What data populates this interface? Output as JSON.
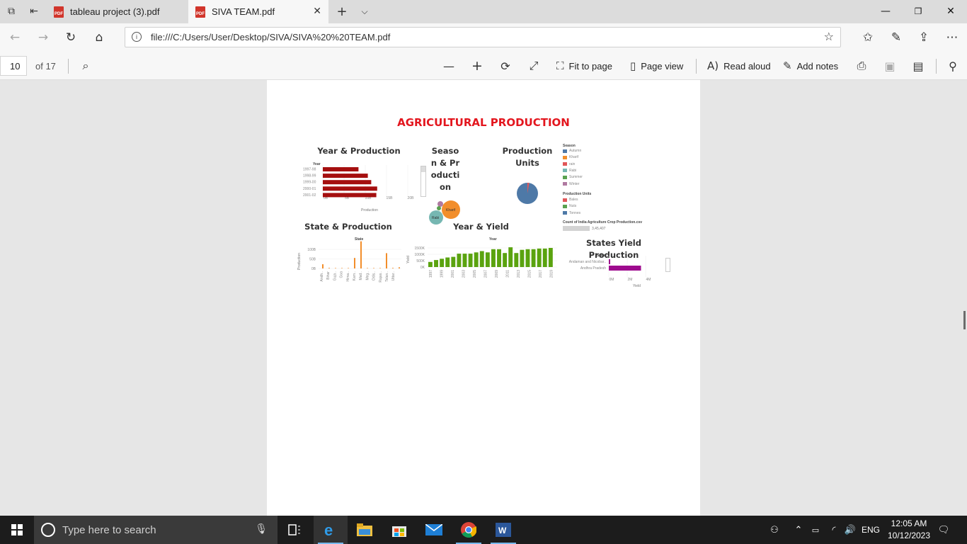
{
  "browser": {
    "tabs": [
      {
        "label": "tableau project (3).pdf",
        "active": false
      },
      {
        "label": "SIVA TEAM.pdf",
        "active": true
      }
    ],
    "url": "file:///C:/Users/User/Desktop/SIVA/SIVA%20%20TEAM.pdf"
  },
  "pdf_toolbar": {
    "page_number": "10",
    "page_count": "of 17",
    "fit_to_page": "Fit to page",
    "page_view": "Page view",
    "read_aloud": "Read aloud",
    "add_notes": "Add notes"
  },
  "dashboard": {
    "title": "AGRICULTURAL PRODUCTION",
    "charts": {
      "year_production": {
        "title": "Year &  Production",
        "field_label": "Year",
        "xlabel": "Production",
        "categories": [
          "1997-98",
          "1998-99",
          "1999-00",
          "2000-01",
          "2001-02"
        ],
        "values": [
          42,
          53,
          57,
          64,
          63
        ],
        "ticks": [
          "0B",
          "5B",
          "10B",
          "15B",
          "20B"
        ],
        "color": "#a50f0f"
      },
      "season_production": {
        "title_lines": [
          "Seaso",
          "n & Pr",
          "oducti",
          "on"
        ],
        "bubbles": [
          {
            "label": "Kharif",
            "color": "#f28e2b"
          },
          {
            "label": "Rabi",
            "color": "#76b7b2"
          },
          {
            "label": "",
            "color": "#b07aa1"
          },
          {
            "label": "",
            "color": "#59a14f"
          }
        ]
      },
      "production_units": {
        "title_lines": [
          "Production",
          "Units"
        ],
        "colors": [
          "#4e79a7",
          "#e15759"
        ]
      },
      "legend": {
        "season_title": "Season",
        "season_items": [
          {
            "label": "Autumn",
            "color": "#4e79a7"
          },
          {
            "label": "Kharif",
            "color": "#f28e2b"
          },
          {
            "label": "rain",
            "color": "#e15759"
          },
          {
            "label": "Rabi",
            "color": "#76b7b2"
          },
          {
            "label": "Summer",
            "color": "#59a14f"
          },
          {
            "label": "Winter",
            "color": "#b07aa1"
          }
        ],
        "units_title": "Production Units",
        "units_items": [
          {
            "label": "Bales",
            "color": "#e15759"
          },
          {
            "label": "Nuts",
            "color": "#59a14f"
          },
          {
            "label": "Tonnes",
            "color": "#4e79a7"
          }
        ],
        "count_title": "Count of India Agriculture Crop Production.csv",
        "count_value": "3,45,407"
      },
      "state_production": {
        "title": "State & Production",
        "field_label": "State",
        "ylabel": "Production",
        "y_ticks": [
          "0B",
          "50B",
          "100B"
        ],
        "categories": [
          "Andh..",
          "Bihar",
          "Guja..",
          "Goa",
          "Hima..",
          "Karn..",
          "Mad..",
          "Meg..",
          "Odis..",
          "Rajas..",
          "Telan..",
          "Uttar.."
        ],
        "values": [
          22,
          3,
          0,
          1,
          1,
          55,
          142,
          1,
          0,
          1,
          80,
          3,
          6
        ],
        "color": "#f28e2b"
      },
      "year_yield": {
        "title": "Year & Yield",
        "field_label": "Year",
        "ylabel": "Yield",
        "y_ticks": [
          "0K",
          "500K",
          "1000K",
          "1500K"
        ],
        "x_ticks": [
          "1997",
          "1999",
          "2001",
          "2003",
          "2005",
          "2007",
          "2009",
          "2011",
          "2013",
          "2015",
          "2017",
          "2019"
        ],
        "values": [
          400,
          550,
          650,
          750,
          800,
          1050,
          1050,
          1050,
          1150,
          1250,
          1150,
          1400,
          1400,
          1100,
          1550,
          1100,
          1350,
          1400,
          1400,
          1450,
          1450,
          1500
        ],
        "color": "#5aa30f"
      },
      "states_yield": {
        "title": "States Yield Production",
        "field_label": "State",
        "xlabel": "Yield",
        "categories": [
          "Andaman and Nicobar..",
          "Andhra Pradesh"
        ],
        "values": [
          0.1,
          3.5
        ],
        "x_ticks": [
          "0M",
          "2M",
          "4M"
        ],
        "color": "#9e0a8e"
      }
    }
  },
  "taskbar": {
    "search_placeholder": "Type here to search",
    "language": "ENG",
    "time": "12:05 AM",
    "date": "10/12/2023"
  }
}
